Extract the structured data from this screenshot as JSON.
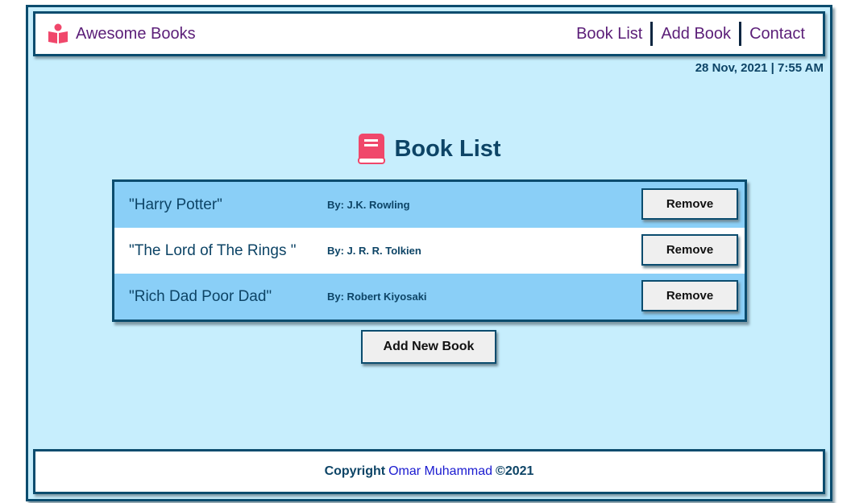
{
  "header": {
    "brand": "Awesome Books",
    "nav": [
      {
        "label": "Book List"
      },
      {
        "label": "Add Book"
      },
      {
        "label": "Contact"
      }
    ]
  },
  "datetime": "28 Nov, 2021 | 7:55 AM",
  "main": {
    "title": "Book List",
    "books": [
      {
        "title": "\"Harry Potter\"",
        "author": "By: J.K. Rowling",
        "remove_label": "Remove"
      },
      {
        "title": "\"The Lord of The Rings \"",
        "author": "By: J. R. R. Tolkien",
        "remove_label": "Remove"
      },
      {
        "title": "\"Rich Dad Poor Dad\"",
        "author": "By: Robert Kiyosaki",
        "remove_label": "Remove"
      }
    ],
    "add_label": "Add New Book"
  },
  "footer": {
    "prefix": "Copyright",
    "author": "Omar Muhammad",
    "year": "©2021"
  },
  "colors": {
    "background": "#c7eefd",
    "border": "#0b4c6e",
    "row_alt": "#8acff7",
    "brand_text": "#5b1e78",
    "icon": "#f0476b"
  },
  "icons": {
    "brand": "reader-icon",
    "title": "book-icon"
  }
}
